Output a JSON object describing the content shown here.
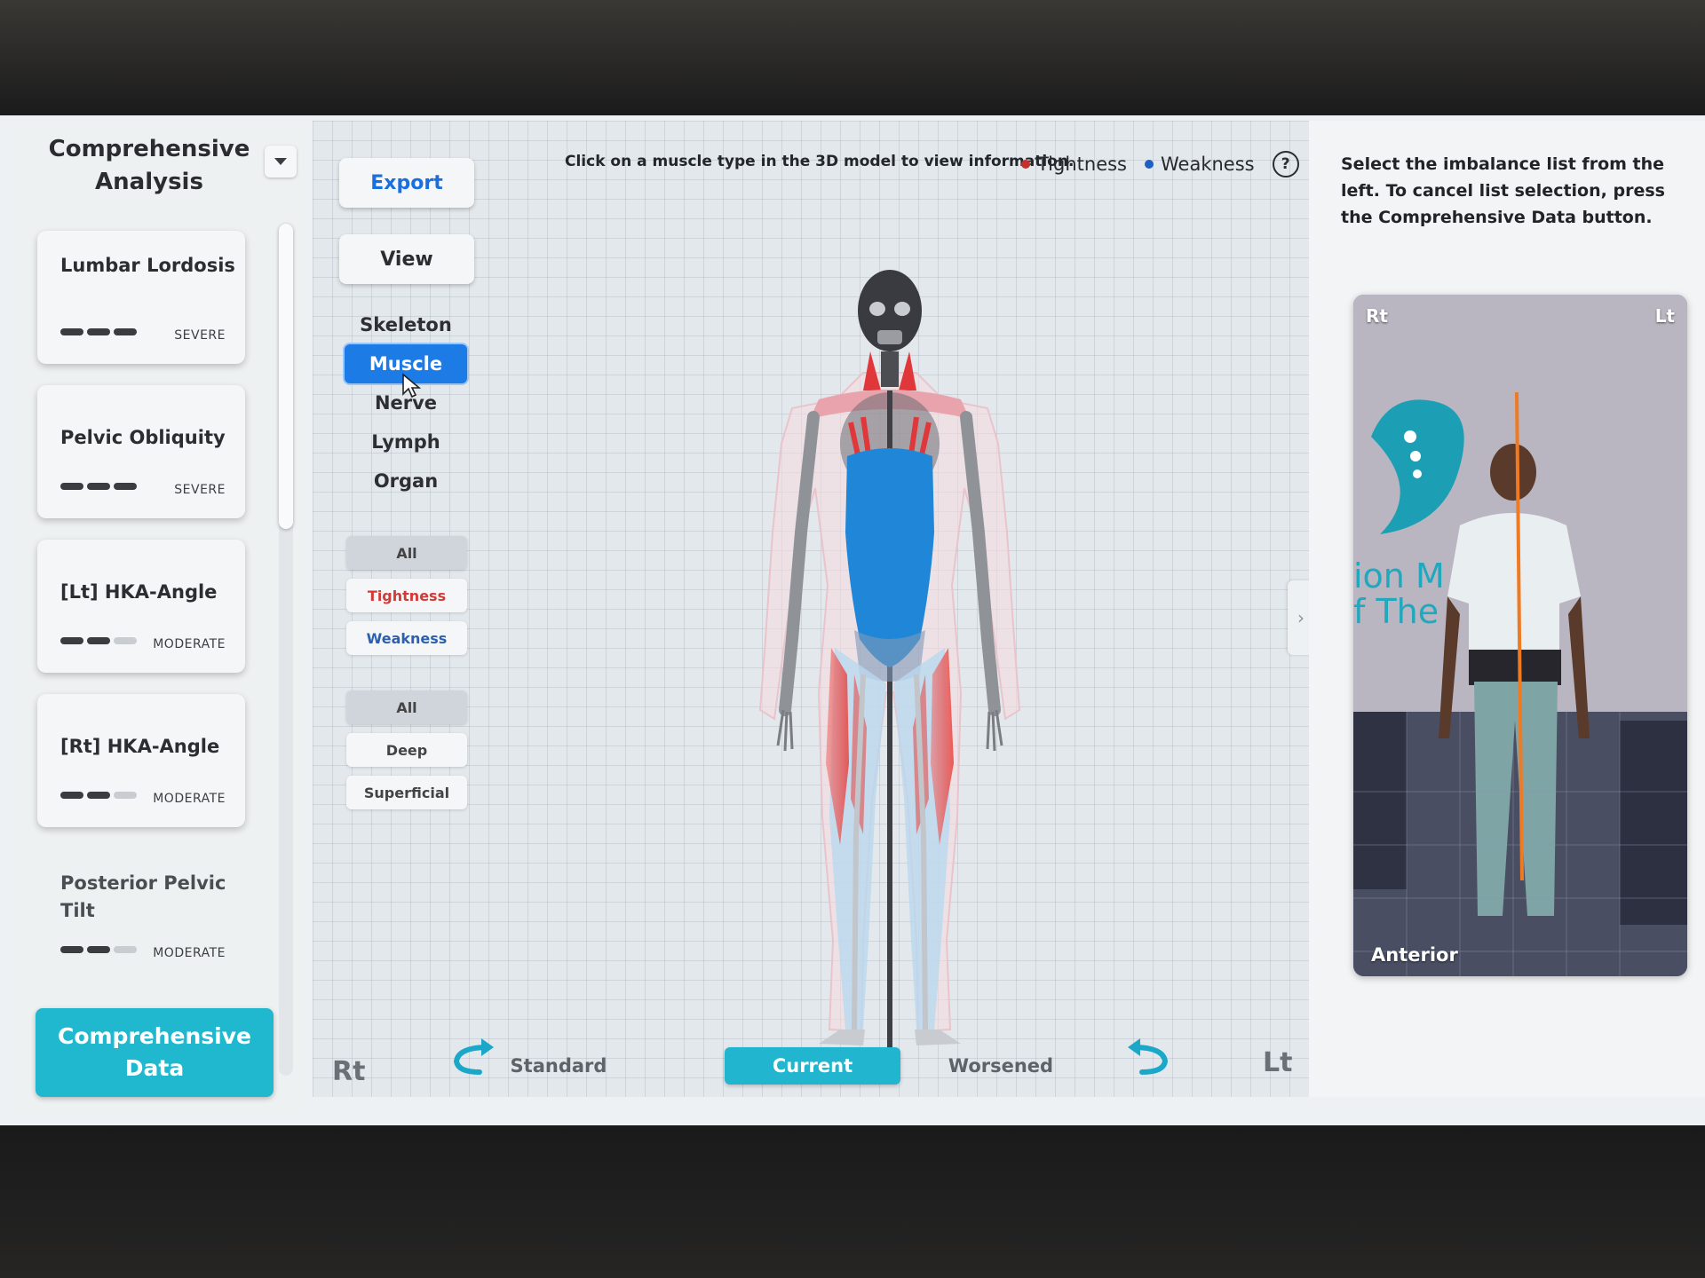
{
  "left_panel": {
    "title": "Comprehensive Analysis",
    "cards": [
      {
        "title": "Lumbar Lordosis",
        "severity": "SEVERE",
        "level": 3
      },
      {
        "title": "Pelvic Obliquity",
        "severity": "SEVERE",
        "level": 3
      },
      {
        "title": "[Lt] HKA-Angle",
        "severity": "MODERATE",
        "level": 2
      },
      {
        "title": "[Rt] HKA-Angle",
        "severity": "MODERATE",
        "level": 2
      },
      {
        "title": "Posterior Pelvic Tilt",
        "severity": "MODERATE",
        "level": 2
      }
    ],
    "comprehensive_data_button": "Comprehensive Data"
  },
  "tools": {
    "export_label": "Export",
    "view_label": "View",
    "layers": [
      "Skeleton",
      "Muscle",
      "Nerve",
      "Lymph",
      "Organ"
    ],
    "active_layer": "Muscle",
    "filter_type": [
      "All",
      "Tightness",
      "Weakness"
    ],
    "filter_depth": [
      "All",
      "Deep",
      "Superficial"
    ]
  },
  "viewport": {
    "hint": "Click on a muscle type in the 3D model to view information.",
    "legend": {
      "tightness_label": "Tightness",
      "weakness_label": "Weakness",
      "tightness_color": "#c4302b",
      "weakness_color": "#1f5fbf"
    },
    "help_glyph": "?",
    "expand_glyph": "›",
    "rt_label": "Rt",
    "lt_label": "Lt",
    "states": [
      "Standard",
      "Current",
      "Worsened"
    ],
    "active_state": "Current"
  },
  "right_panel": {
    "instructions": "Select the imbalance list from the left. To cancel list selection, press the Comprehensive Data button.",
    "photo": {
      "rt_label": "Rt",
      "lt_label": "Lt",
      "view_label": "Anterior",
      "backdrop_text_line1": "ion M",
      "backdrop_text_line2": "f The"
    }
  },
  "colors": {
    "accent_teal": "#21b5d0",
    "active_blue": "#1d7be6",
    "export_blue": "#1a6fe0"
  }
}
